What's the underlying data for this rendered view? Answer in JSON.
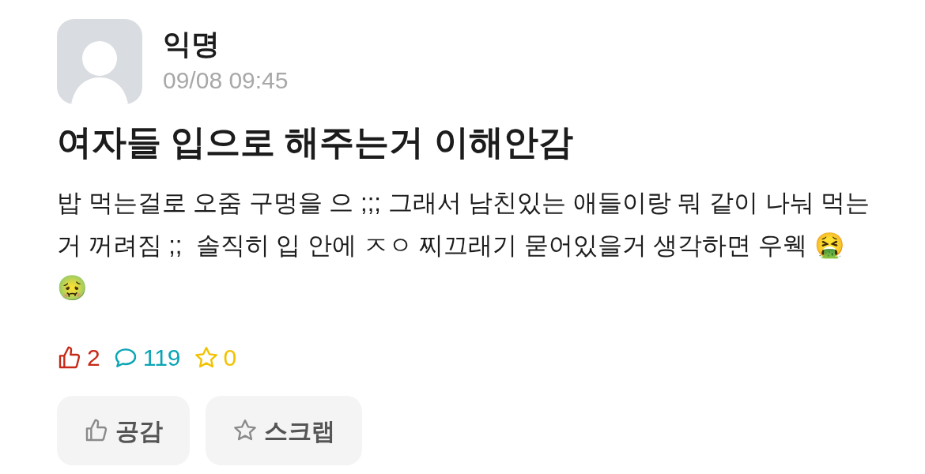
{
  "post": {
    "author": "익명",
    "time": "09/08 09:45",
    "title": "여자들 입으로 해주는거 이해안감",
    "body": "밥 먹는걸로 오줌 구멍을 으 ;;; 그래서 남친있는 애들이랑 뭐 같이 나눠 먹는거 꺼려짐 ;;  솔직히 입 안에 ㅈㅇ 찌끄래기 묻어있을거 생각하면 우웩 🤮 🤢"
  },
  "counters": [
    {
      "kind": "like",
      "value": "2",
      "color": "#c62917"
    },
    {
      "kind": "comment",
      "value": "119",
      "color": "#0ba5b5"
    },
    {
      "kind": "scrap",
      "value": "0",
      "color": "#f2c200"
    }
  ],
  "buttons": [
    {
      "kind": "like",
      "label": "공감"
    },
    {
      "kind": "scrap",
      "label": "스크랩"
    }
  ]
}
